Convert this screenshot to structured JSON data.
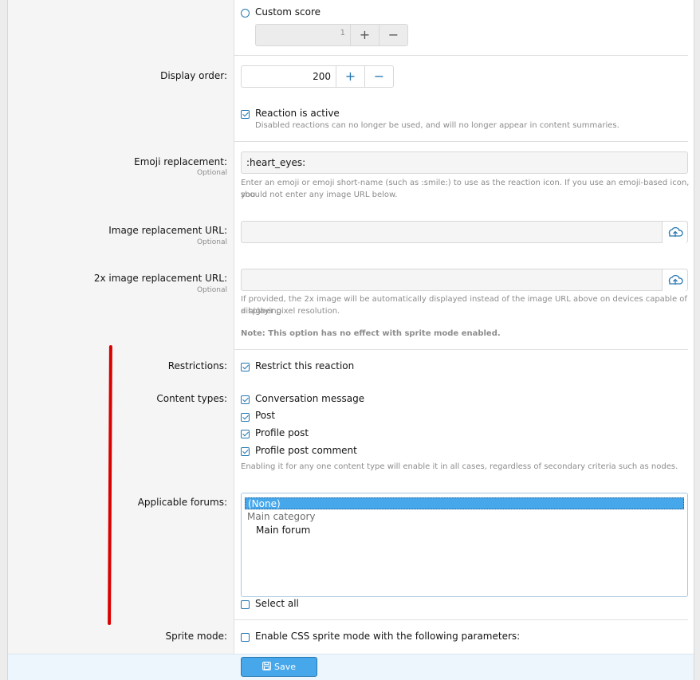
{
  "score": {
    "custom_label": "Custom score",
    "custom_value": "1"
  },
  "display_order": {
    "label": "Display order:",
    "value": "200"
  },
  "active": {
    "label": "Reaction is active",
    "hint": "Disabled reactions can no longer be used, and will no longer appear in content summaries.",
    "checked": true
  },
  "emoji": {
    "label": "Emoji replacement:",
    "optional": "Optional",
    "value": ":heart_eyes:",
    "hint_line1": "Enter an emoji or emoji short-name (such as :smile:) to use as the reaction icon. If you use an emoji-based icon, you",
    "hint_line2": "should not enter any image URL below."
  },
  "image_url": {
    "label": "Image replacement URL:",
    "optional": "Optional",
    "value": ""
  },
  "image_url_2x": {
    "label": "2x image replacement URL:",
    "optional": "Optional",
    "value": "",
    "hint_line1": "If provided, the 2x image will be automatically displayed instead of the image URL above on devices capable of displaying",
    "hint_line2": "a higher pixel resolution.",
    "note": "Note: This option has no effect with sprite mode enabled."
  },
  "restrictions": {
    "label": "Restrictions:",
    "option": "Restrict this reaction",
    "checked": true
  },
  "content_types": {
    "label": "Content types:",
    "items": [
      {
        "label": "Conversation message",
        "checked": true
      },
      {
        "label": "Post",
        "checked": true
      },
      {
        "label": "Profile post",
        "checked": true
      },
      {
        "label": "Profile post comment",
        "checked": true
      }
    ],
    "hint": "Enabling it for any one content type will enable it in all cases, regardless of secondary criteria such as nodes."
  },
  "forums": {
    "label": "Applicable forums:",
    "options": [
      "(None)",
      "Main category",
      "Main forum"
    ],
    "selected": "(None)",
    "select_all": "Select all"
  },
  "sprite": {
    "label": "Sprite mode:",
    "option": "Enable CSS sprite mode with the following parameters:"
  },
  "footer": {
    "save_label": "Save"
  },
  "icons": {
    "plus": "+",
    "minus": "−"
  },
  "colors": {
    "accent": "#47a7eb",
    "accent_dark": "#2577b1",
    "annotation": "#d90000"
  }
}
